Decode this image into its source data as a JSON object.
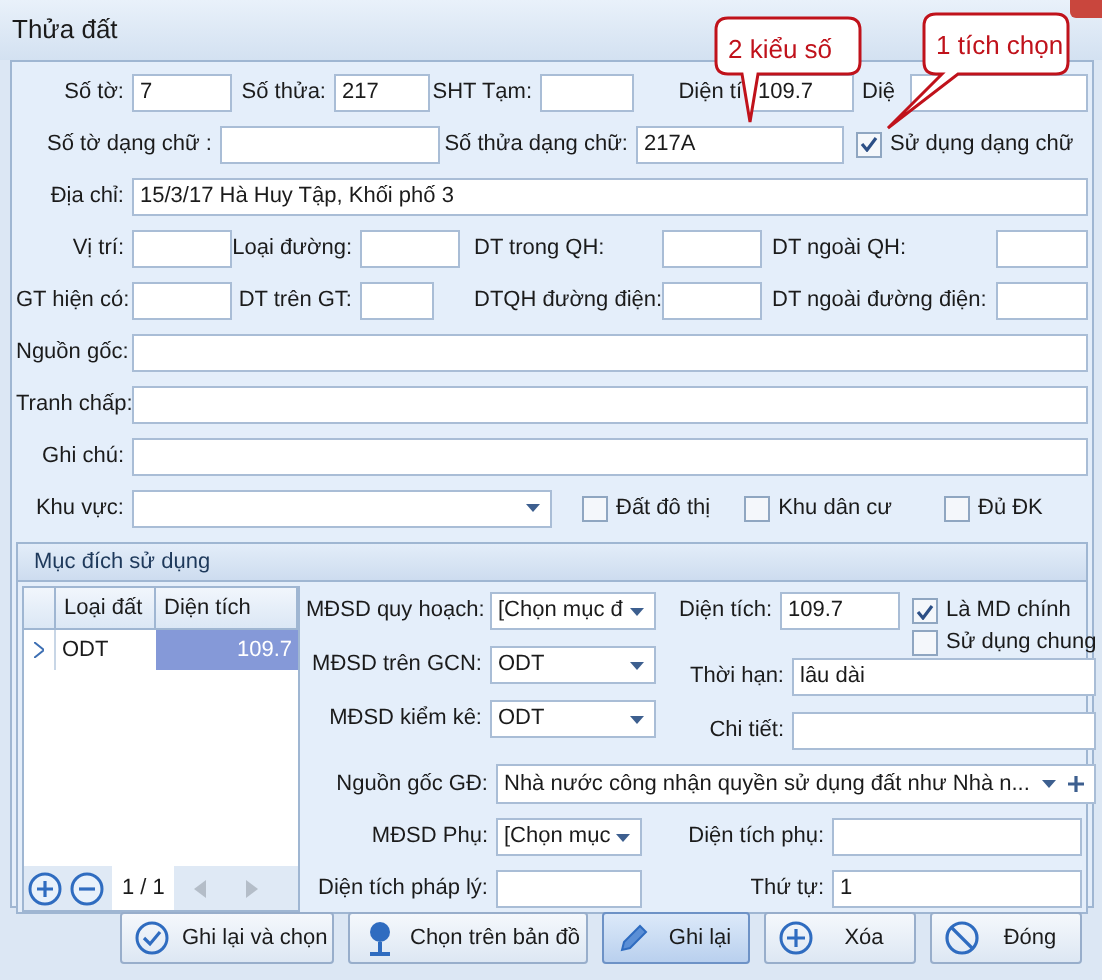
{
  "window": {
    "title": "Thửa đất"
  },
  "callouts": [
    {
      "text": "2 kiểu số"
    },
    {
      "text": "1 tích chọn"
    }
  ],
  "rows": [
    [
      {
        "kind": "field",
        "label": "Số tờ:",
        "value": "7"
      },
      {
        "kind": "field",
        "label": "Số thửa:",
        "value": "217"
      },
      {
        "kind": "field",
        "label": "SHT Tạm:"
      },
      {
        "kind": "field",
        "label": "Diện tí",
        "value": "109.7"
      },
      {
        "kind": "field",
        "label": "Diệ"
      }
    ],
    [
      {
        "kind": "field",
        "label": "Số tờ dạng chữ :"
      },
      {
        "kind": "field",
        "label": "Số thửa dạng chữ:",
        "value": "217A"
      },
      {
        "kind": "checkbox",
        "label": "Sử dụng dạng chữ",
        "checked": true
      }
    ],
    [
      {
        "kind": "field",
        "label": "Địa chỉ:",
        "value": "15/3/17 Hà Huy Tập, Khối phố 3"
      }
    ],
    [
      {
        "kind": "field",
        "label": "Vị trí:"
      },
      {
        "kind": "field",
        "label": "Loại đường:"
      },
      {
        "kind": "field",
        "label": "DT trong QH:"
      },
      {
        "kind": "field",
        "label": "DT ngoài QH:"
      }
    ],
    [
      {
        "kind": "field",
        "label": "GT hiện có:"
      },
      {
        "kind": "field",
        "label": "DT trên GT:"
      },
      {
        "kind": "field",
        "label": "DTQH đường điện:"
      },
      {
        "kind": "field",
        "label": "DT ngoài đường điện:"
      }
    ],
    [
      {
        "kind": "field",
        "label": "Nguồn gốc:"
      }
    ],
    [
      {
        "kind": "field",
        "label": "Tranh chấp:"
      }
    ],
    [
      {
        "kind": "field",
        "label": "Ghi chú:"
      }
    ],
    [
      {
        "kind": "dropdown",
        "label": "Khu vực:"
      },
      {
        "kind": "checkbox",
        "label": "Đất đô thị",
        "checked": false
      },
      {
        "kind": "checkbox",
        "label": "Khu dân cư",
        "checked": false
      },
      {
        "kind": "checkbox",
        "label": "Đủ ĐK",
        "checked": false
      }
    ]
  ],
  "usage": {
    "title": "Mục đích sử dụng",
    "grid": {
      "columns": [
        "Loại đất",
        "Diện tích"
      ],
      "rows": [
        {
          "cells": [
            "ODT",
            "109.7"
          ],
          "selected": true
        }
      ],
      "pager": "1 / 1"
    },
    "left": [
      {
        "kind": "dropdown",
        "label": "MĐSD quy hoạch:",
        "value": "[Chọn mục đ"
      },
      {
        "kind": "dropdown",
        "label": "MĐSD trên GCN:",
        "value": "ODT"
      },
      {
        "kind": "dropdown",
        "label": "MĐSD kiểm kê:",
        "value": "ODT"
      }
    ],
    "area": {
      "label": "Diện tích:",
      "value": "109.7"
    },
    "checks": [
      {
        "label": "Là MD chính",
        "checked": true
      },
      {
        "label": "Sử dụng chung",
        "checked": false
      }
    ],
    "right": [
      {
        "label": "Thời hạn:",
        "value": "lâu dài"
      },
      {
        "label": "Chi tiết:"
      }
    ],
    "origin": {
      "label": "Nguồn gốc GĐ:",
      "value": "Nhà nước công nhận quyền sử dụng đất như Nhà n..."
    },
    "bottom": [
      [
        {
          "kind": "dropdown",
          "label": "MĐSD Phụ:",
          "value": "[Chọn mục"
        },
        {
          "kind": "field",
          "label": "Diện tích phụ:"
        }
      ],
      [
        {
          "kind": "field",
          "label": "Diện tích pháp lý:"
        },
        {
          "kind": "field",
          "label": "Thứ tự:",
          "value": "1"
        }
      ]
    ]
  },
  "buttons": [
    {
      "label": "Ghi lại và chọn",
      "selected": false
    },
    {
      "label": "Chọn trên bản đồ",
      "selected": false
    },
    {
      "label": "Ghi lại",
      "selected": true
    },
    {
      "label": "Xóa",
      "selected": false
    },
    {
      "label": "Đóng",
      "selected": false
    }
  ]
}
